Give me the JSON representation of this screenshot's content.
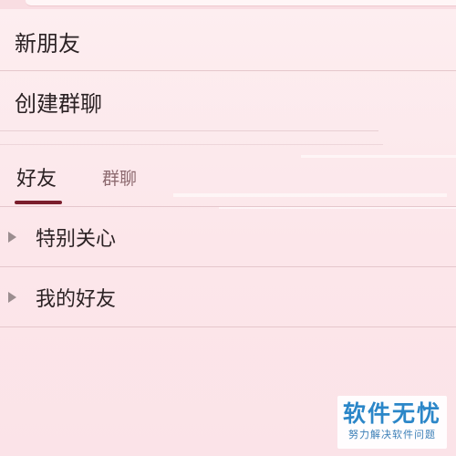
{
  "menu": {
    "new_friends": "新朋友",
    "create_group": "创建群聊"
  },
  "tabs": {
    "friends": "好友",
    "groups": "群聊",
    "active": "friends"
  },
  "groups": [
    {
      "label": "特别关心"
    },
    {
      "label": "我的好友"
    }
  ],
  "watermark": {
    "title": "软件无忧",
    "subtitle": "努力解决软件问题"
  },
  "colors": {
    "background": "#fce6ea",
    "accent": "#7a1e2c",
    "text": "#2b2224",
    "inactive_tab": "#8d6a70",
    "watermark": "#2b86c8"
  }
}
